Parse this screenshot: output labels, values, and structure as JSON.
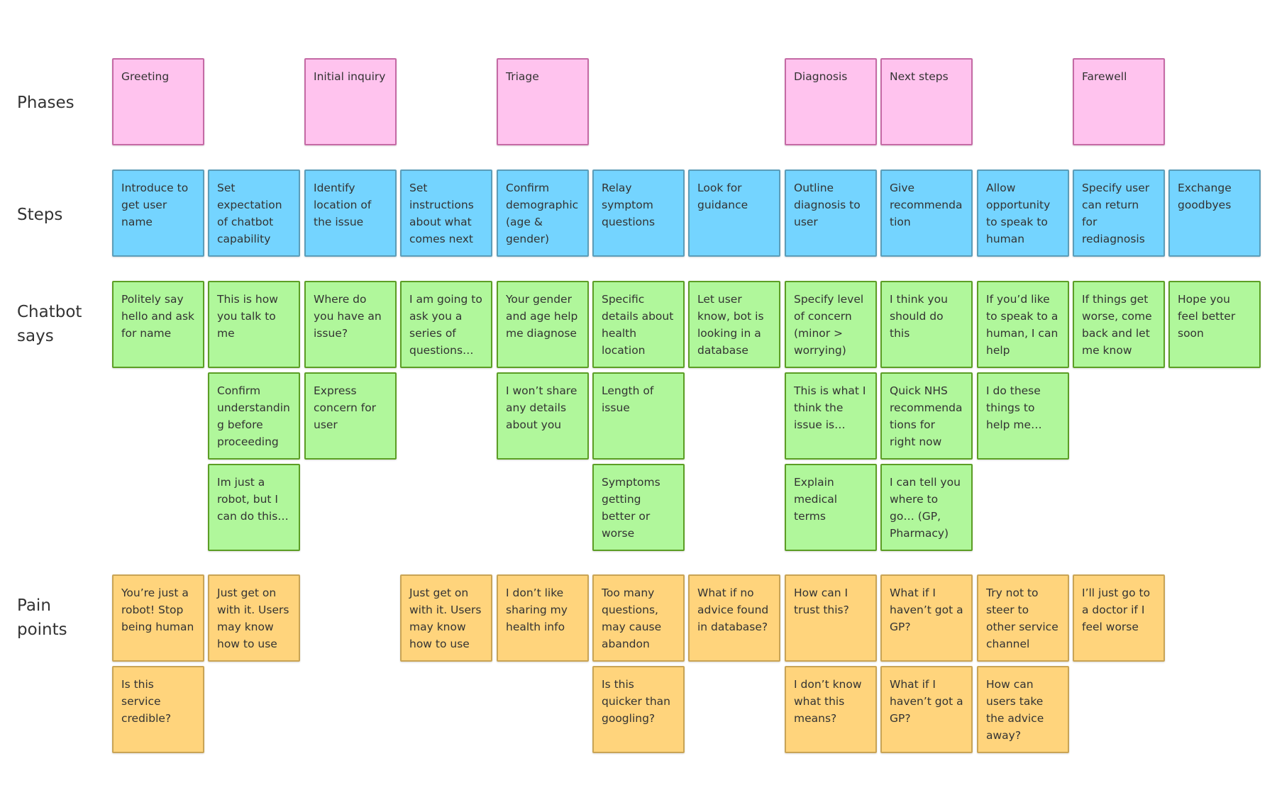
{
  "row_labels": {
    "phases": "Phases",
    "steps": "Steps",
    "chatbot": "Chatbot\nsays",
    "pain": "Pain\npoints"
  },
  "colors": {
    "phase": "#ffc3ee",
    "step": "#74d4ff",
    "chatbot": "#b0f79b",
    "pain": "#ffd47c"
  },
  "columns": [
    {
      "phase": "Greeting",
      "step": "Introduce to get user name",
      "chatbot": [
        "Politely say hello and ask for name"
      ],
      "pain": [
        "You’re just a robot! Stop being human",
        "Is this service credible?"
      ]
    },
    {
      "phase": null,
      "step": "Set expectation of chatbot capability",
      "chatbot": [
        "This is how you talk to me",
        "Confirm understanding before proceeding",
        "Im just a robot, but I can do this…"
      ],
      "pain": [
        "Just get on with it. Users may know how to use"
      ]
    },
    {
      "phase": "Initial inquiry",
      "step": "Identify location of the issue",
      "chatbot": [
        "Where do you have an issue?",
        "Express concern for user"
      ],
      "pain": []
    },
    {
      "phase": null,
      "step": "Set instructions about what comes next",
      "chatbot": [
        "I am going to ask you a series of questions…"
      ],
      "pain": [
        "Just get on with it. Users may know how to use"
      ]
    },
    {
      "phase": "Triage",
      "step": "Confirm demographic (age & gender)",
      "chatbot": [
        "Your gender and age help me diagnose",
        "I won’t share any details about you"
      ],
      "pain": [
        "I don’t like sharing my health info"
      ]
    },
    {
      "phase": null,
      "step": "Relay symptom questions",
      "chatbot": [
        "Specific details about health location",
        "Length of issue",
        "Symptoms getting better or worse"
      ],
      "pain": [
        "Too many questions, may cause abandon",
        "Is this quicker than googling?"
      ]
    },
    {
      "phase": null,
      "step": "Look for guidance",
      "chatbot": [
        "Let user know, bot is looking in a database"
      ],
      "pain": [
        "What if no advice found in database?"
      ]
    },
    {
      "phase": "Diagnosis",
      "step": "Outline diagnosis to user",
      "chatbot": [
        "Specify level of concern (minor > worrying)",
        "This is what I think the issue is…",
        "Explain medical terms"
      ],
      "pain": [
        "How can I trust this?",
        "I don’t know what this means?"
      ]
    },
    {
      "phase": "Next steps",
      "step": "Give recommendation",
      "chatbot": [
        "I think you should do this",
        "Quick NHS recommendations for right now",
        "I can tell you where to go… (GP, Pharmacy)"
      ],
      "pain": [
        "What if I haven’t got a GP?",
        "What if I haven’t got a GP?"
      ]
    },
    {
      "phase": null,
      "step": "Allow opportunity to speak to human",
      "chatbot": [
        "If you’d like to speak to a human, I can help",
        "I do these things to help me…"
      ],
      "pain": [
        "Try not to steer to other service channel",
        "How can users take the advice away?"
      ]
    },
    {
      "phase": "Farewell",
      "step": "Specify user can return for rediagnosis",
      "chatbot": [
        "If things get worse, come back and let me know"
      ],
      "pain": [
        "I’ll just go to a doctor if I feel worse"
      ]
    },
    {
      "phase": null,
      "step": "Exchange goodbyes",
      "chatbot": [
        "Hope you feel better soon"
      ],
      "pain": []
    }
  ]
}
